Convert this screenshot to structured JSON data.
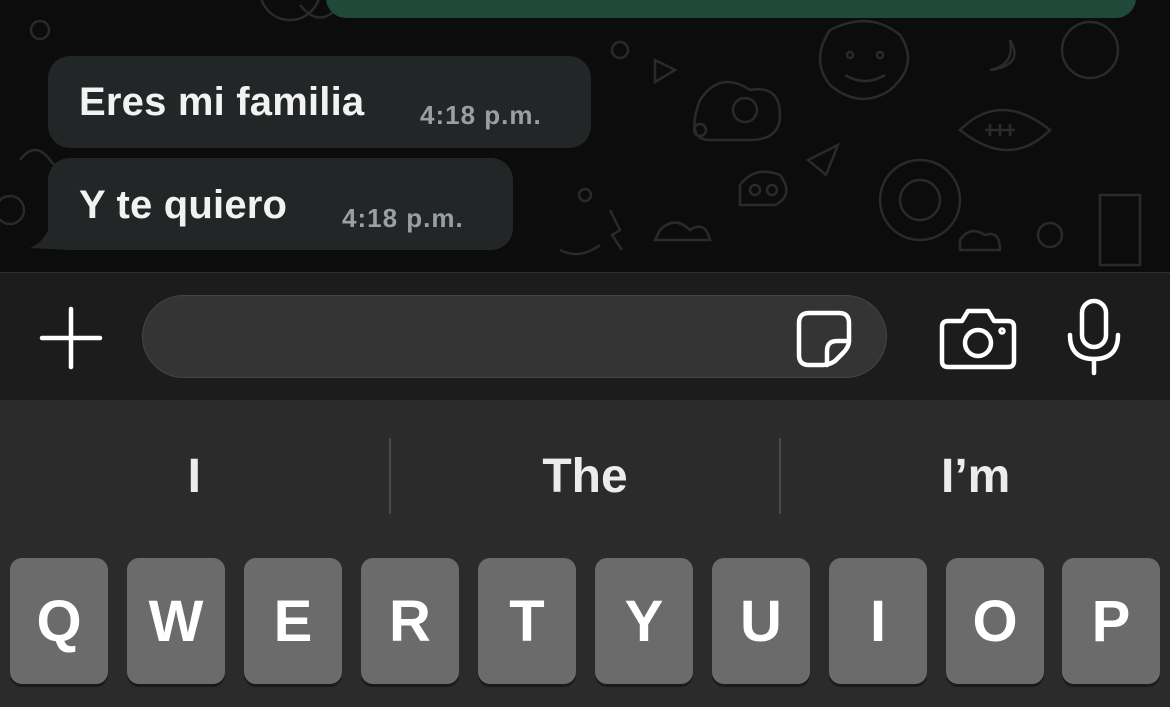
{
  "chat": {
    "messages": [
      {
        "text": "Eres mi familia",
        "time": "4:18 p.m."
      },
      {
        "text": "Y te quiero",
        "time": "4:18 p.m."
      }
    ]
  },
  "composer": {
    "placeholder": "",
    "icons": {
      "add": "plus-icon",
      "sticker": "sticker-icon",
      "camera": "camera-icon",
      "mic": "microphone-icon"
    }
  },
  "keyboard": {
    "suggestions": [
      "I",
      "The",
      "I’m"
    ],
    "row1": [
      "Q",
      "W",
      "E",
      "R",
      "T",
      "Y",
      "U",
      "I",
      "O",
      "P"
    ]
  },
  "colors": {
    "chat_background": "#0c0c0c",
    "received_bubble": "#232626",
    "sent_bubble": "#1f4a3a",
    "keyboard_background": "#2b2b2b",
    "key": "#6b6b6b"
  }
}
